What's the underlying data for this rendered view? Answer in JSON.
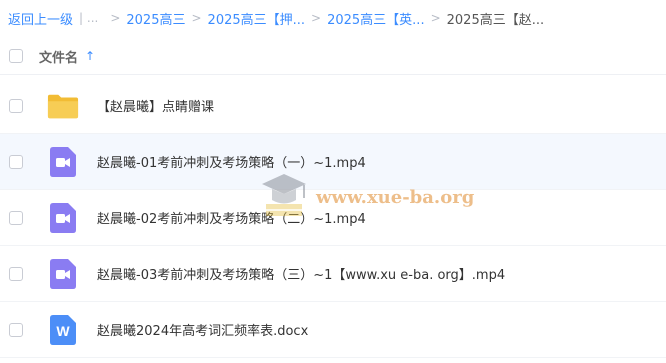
{
  "breadcrumb": {
    "back": "返回上一级",
    "ellipsis": "| ...",
    "items": [
      "2025高三",
      "2025高三【押...",
      "2025高三【英...",
      "2025高三【赵..."
    ],
    "separator": ">"
  },
  "header": {
    "column_label": "文件名",
    "sort_icon": "arrow-up-icon"
  },
  "files": [
    {
      "name": "【赵晨曦】点睛赠课",
      "type": "folder",
      "icon": "folder-icon"
    },
    {
      "name": "赵晨曦-01考前冲刺及考场策略（一）~1.mp4",
      "type": "video",
      "icon": "video-file-icon"
    },
    {
      "name": "赵晨曦-02考前冲刺及考场策略（二）~1.mp4",
      "type": "video",
      "icon": "video-file-icon"
    },
    {
      "name": "赵晨曦-03考前冲刺及考场策略（三）~1【www.xu e-ba. org】.mp4",
      "type": "video",
      "icon": "video-file-icon"
    },
    {
      "name": "赵晨曦2024年高考词汇频率表.docx",
      "type": "word",
      "icon": "word-file-icon",
      "icon_letter": "W"
    }
  ],
  "watermark": {
    "text": "www.xue-ba.org"
  },
  "colors": {
    "accent": "#3b8cff",
    "folder": "#f7c94a",
    "video": "#8a7cf2",
    "word": "#4c8ef7"
  }
}
